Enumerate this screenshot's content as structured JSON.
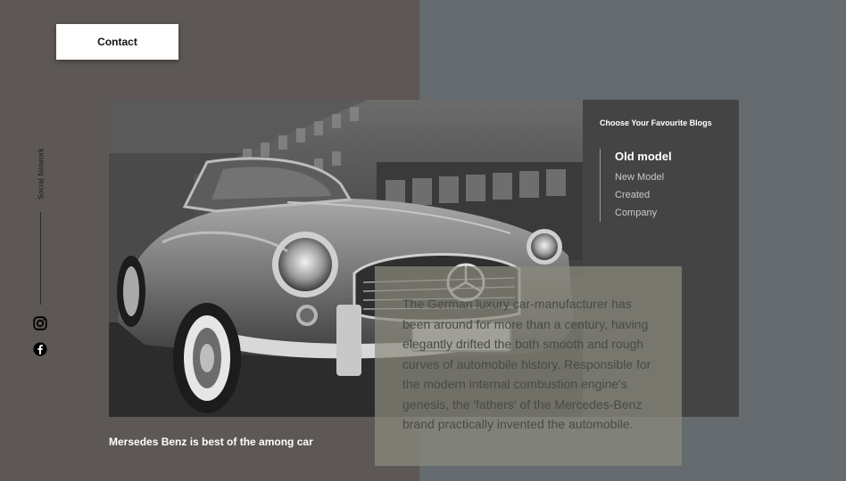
{
  "header": {
    "contact_label": "Contact"
  },
  "social": {
    "label": "Social Network",
    "icons": [
      "instagram-icon",
      "facebook-icon"
    ]
  },
  "hero": {
    "image": "vintage-car-photo",
    "caption": "Mersedes Benz is best of the among car"
  },
  "blogs": {
    "heading": "Choose Your Favourite Blogs",
    "items": [
      {
        "label": "Old model",
        "active": true
      },
      {
        "label": "New Model",
        "active": false
      },
      {
        "label": "Created",
        "active": false
      },
      {
        "label": "Company",
        "active": false
      }
    ]
  },
  "description": {
    "text": "The German luxury car-manufacturer has been around for more than a century, having elegantly drifted the both smooth and rough curves of automobile history. Responsible for the modern internal combustion engine's genesis, the 'fathers' of the Mercedes-Benz brand practically invented the automobile."
  },
  "colors": {
    "left_bg": "#5d5856",
    "right_bg": "#646a6d",
    "panel_bg": "#444444",
    "overlay_bg": "#8a8a7e"
  }
}
